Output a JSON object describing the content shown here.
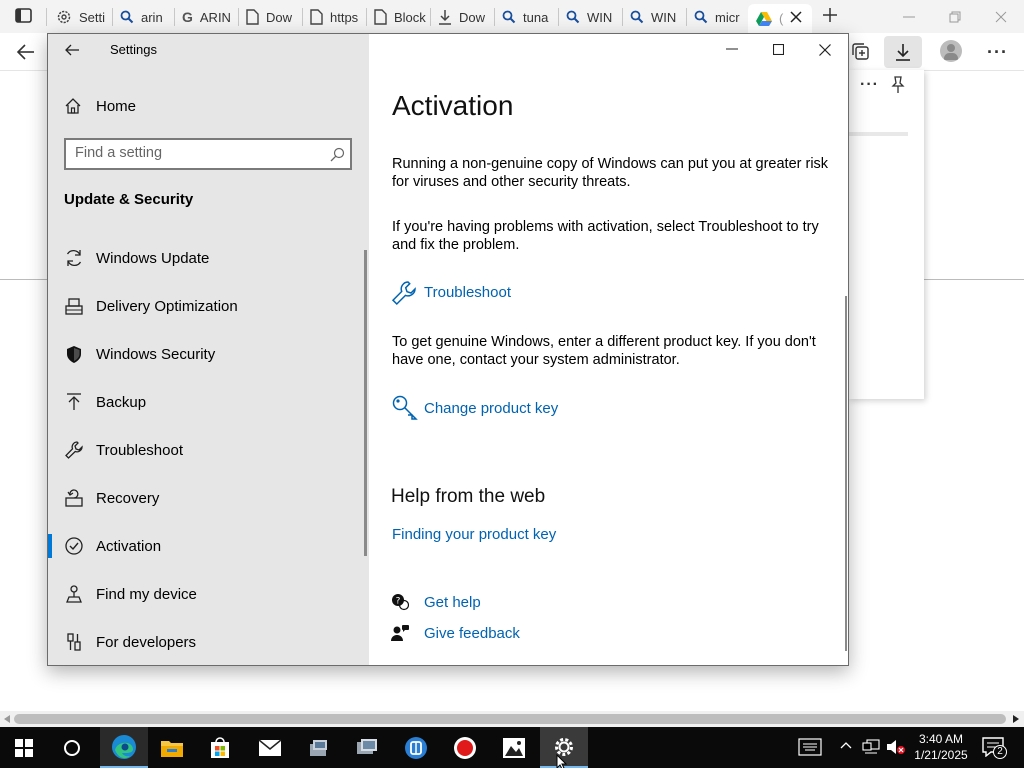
{
  "browser": {
    "tabs": [
      {
        "label": "Setti",
        "icon": "gear-icon"
      },
      {
        "label": "arin",
        "icon": "search-icon"
      },
      {
        "label": "ARIN",
        "icon": "google-icon"
      },
      {
        "label": "Dow",
        "icon": "page-icon"
      },
      {
        "label": "https",
        "icon": "page-icon"
      },
      {
        "label": "Block",
        "icon": "page-icon"
      },
      {
        "label": "Dow",
        "icon": "download-icon"
      },
      {
        "label": "tuna",
        "icon": "search-icon"
      },
      {
        "label": "WIN",
        "icon": "search-icon"
      },
      {
        "label": "WIN",
        "icon": "search-icon"
      },
      {
        "label": "micr",
        "icon": "search-icon"
      },
      {
        "label": "(",
        "icon": "drive-icon"
      }
    ]
  },
  "settings": {
    "window_title": "Settings",
    "home_label": "Home",
    "search_placeholder": "Find a setting",
    "section_title": "Update & Security",
    "nav": [
      {
        "label": "Windows Update",
        "icon": "refresh-icon"
      },
      {
        "label": "Delivery Optimization",
        "icon": "delivery-icon"
      },
      {
        "label": "Windows Security",
        "icon": "shield-icon"
      },
      {
        "label": "Backup",
        "icon": "backup-icon"
      },
      {
        "label": "Troubleshoot",
        "icon": "wrench-icon"
      },
      {
        "label": "Recovery",
        "icon": "recovery-icon"
      },
      {
        "label": "Activation",
        "icon": "activation-icon"
      },
      {
        "label": "Find my device",
        "icon": "find-device-icon"
      },
      {
        "label": "For developers",
        "icon": "developer-icon"
      }
    ],
    "selected_nav": "Activation",
    "content": {
      "title": "Activation",
      "para1": "Running a non-genuine copy of Windows can put you at greater risk for viruses and other security threats.",
      "para2": "If you're having problems with activation, select Troubleshoot to try and fix the problem.",
      "troubleshoot_link": "Troubleshoot",
      "para3": "To get genuine Windows, enter a different product key. If you don't have one, contact your system administrator.",
      "change_key_link": "Change product key",
      "help_heading": "Help from the web",
      "finding_key_link": "Finding your product key",
      "get_help": "Get help",
      "give_feedback": "Give feedback"
    }
  },
  "taskbar": {
    "time": "3:40 AM",
    "date": "1/21/2025",
    "notification_count": "2"
  }
}
